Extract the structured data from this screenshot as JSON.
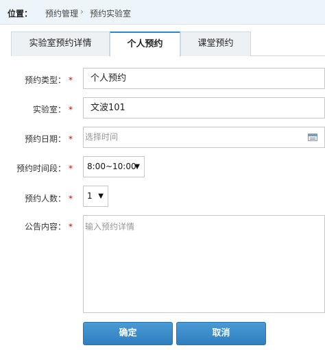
{
  "breadcrumb": {
    "label": "位置：",
    "items": [
      "预约管理",
      "预约实验室"
    ],
    "separator": "›"
  },
  "tabs": [
    {
      "label": "实验室预约详情",
      "active": false
    },
    {
      "label": "个人预约",
      "active": true
    },
    {
      "label": "课堂预约",
      "active": false
    }
  ],
  "form": {
    "type": {
      "label": "预约类型：",
      "required": "*",
      "value": "个人预约"
    },
    "lab": {
      "label": "实验室：",
      "required": "*",
      "value": "文波101"
    },
    "date": {
      "label": "预约日期：",
      "required": "*",
      "placeholder": "选择时间",
      "icon": "calendar-icon"
    },
    "time_slot": {
      "label": "预约时间段：",
      "required": "*",
      "selected": "8:00~10:00",
      "arrow": "▼"
    },
    "people": {
      "label": "预约人数：",
      "required": "*",
      "selected": "1",
      "arrow": "▼"
    },
    "notice": {
      "label": "公告内容：",
      "required": "*",
      "placeholder": "输入预约详情"
    }
  },
  "buttons": {
    "confirm": "确定",
    "cancel": "取消"
  },
  "colors": {
    "accent": "#2a86c8",
    "required": "#d40000",
    "button": "#3a8ccb"
  }
}
